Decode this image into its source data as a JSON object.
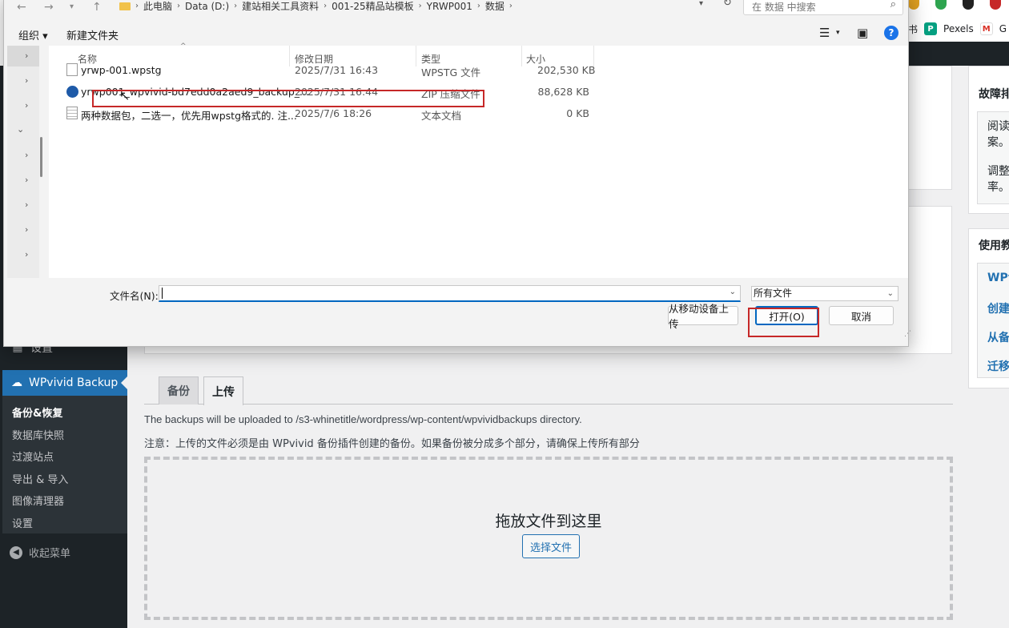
{
  "dialog": {
    "breadcrumbs": [
      "此电脑",
      "Data (D:)",
      "建站相关工具资料",
      "001-25精品站模板",
      "YRWP001",
      "数据"
    ],
    "search_placeholder": "在 数据 中搜索",
    "toolbar": {
      "organize": "组织 ▾",
      "new_folder": "新建文件夹"
    },
    "columns": {
      "name": "名称",
      "date": "修改日期",
      "type": "类型",
      "size": "大小"
    },
    "files": [
      {
        "name": "yrwp-001.wpstg",
        "date": "2025/7/31 16:43",
        "type": "WPSTG 文件",
        "size": "202,530 KB"
      },
      {
        "name": "yrwp001_wpvivid-bd7edd0a2aed9_backup_...",
        "date": "2025/7/31 16:44",
        "type": "ZIP 压缩文件",
        "size": "88,628 KB"
      },
      {
        "name": "两种数据包，二选一，优先用wpstg格式的. 注...",
        "date": "2025/7/6 18:26",
        "type": "文本文档",
        "size": "0 KB"
      }
    ],
    "filename_label": "文件名(N):",
    "filename_value": "",
    "filetype_value": "所有文件",
    "btn_upload_mobile": "从移动设备上传",
    "btn_open": "打开(O)",
    "btn_cancel": "取消"
  },
  "browser": {
    "bookmarks": [
      "书",
      "Pexels",
      "G"
    ]
  },
  "wp": {
    "menu": {
      "settings": "设置",
      "active": "WPvivid Backup",
      "submenu": [
        "备份&恢复",
        "数据库快照",
        "过渡站点",
        "导出 & 导入",
        "图像清理器",
        "设置"
      ],
      "collapse": "收起菜单"
    },
    "side_panel_1": {
      "title": "故障排",
      "lines": [
        "阅读",
        "案。",
        "调整",
        "率。"
      ]
    },
    "side_panel_2": {
      "title": "使用教",
      "links": [
        "WPvi",
        "创建",
        "从备",
        "迁移"
      ]
    },
    "tabs": {
      "backup": "备份",
      "upload": "上传"
    },
    "upload_dir": "The backups will be uploaded to /s3-whinetitle/wordpress/wp-content/wpvividbackups directory.",
    "upload_notice": "注意：上传的文件必须是由 WPvivid 备份插件创建的备份。如果备份被分成多个部分，请确保上传所有部分",
    "drop_title": "拖放文件到这里",
    "select_files": "选择文件"
  }
}
